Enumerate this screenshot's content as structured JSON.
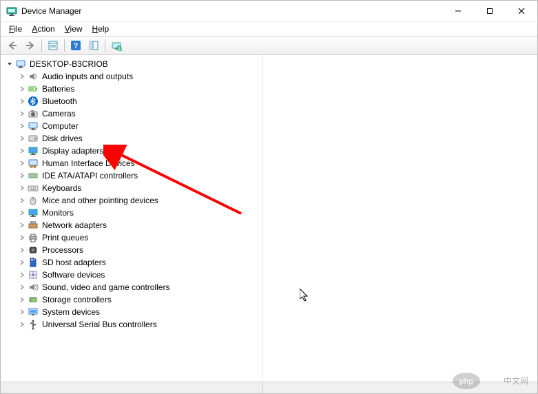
{
  "window": {
    "title": "Device Manager",
    "minimize_tip": "Minimize",
    "maximize_tip": "Maximize",
    "close_tip": "Close"
  },
  "menu": {
    "file": "File",
    "action": "Action",
    "view": "View",
    "help": "Help"
  },
  "toolbar": {
    "back_tip": "Back",
    "forward_tip": "Forward",
    "properties_tip": "Properties",
    "help_tip": "Help",
    "show_hide_tip": "Show hidden devices",
    "scan_tip": "Scan for hardware changes"
  },
  "tree": {
    "root": "DESKTOP-B3CRIOB",
    "items": [
      {
        "label": "Audio inputs and outputs",
        "icon": "audio"
      },
      {
        "label": "Batteries",
        "icon": "battery"
      },
      {
        "label": "Bluetooth",
        "icon": "bluetooth"
      },
      {
        "label": "Cameras",
        "icon": "camera"
      },
      {
        "label": "Computer",
        "icon": "computer"
      },
      {
        "label": "Disk drives",
        "icon": "disk"
      },
      {
        "label": "Display adapters",
        "icon": "display"
      },
      {
        "label": "Human Interface Devices",
        "icon": "hid"
      },
      {
        "label": "IDE ATA/ATAPI controllers",
        "icon": "ide"
      },
      {
        "label": "Keyboards",
        "icon": "keyboard"
      },
      {
        "label": "Mice and other pointing devices",
        "icon": "mouse"
      },
      {
        "label": "Monitors",
        "icon": "monitor"
      },
      {
        "label": "Network adapters",
        "icon": "network"
      },
      {
        "label": "Print queues",
        "icon": "printer"
      },
      {
        "label": "Processors",
        "icon": "cpu"
      },
      {
        "label": "SD host adapters",
        "icon": "sd"
      },
      {
        "label": "Software devices",
        "icon": "software"
      },
      {
        "label": "Sound, video and game controllers",
        "icon": "sound"
      },
      {
        "label": "Storage controllers",
        "icon": "storage"
      },
      {
        "label": "System devices",
        "icon": "system"
      },
      {
        "label": "Universal Serial Bus controllers",
        "icon": "usb"
      }
    ]
  },
  "watermark": "php 中文网"
}
